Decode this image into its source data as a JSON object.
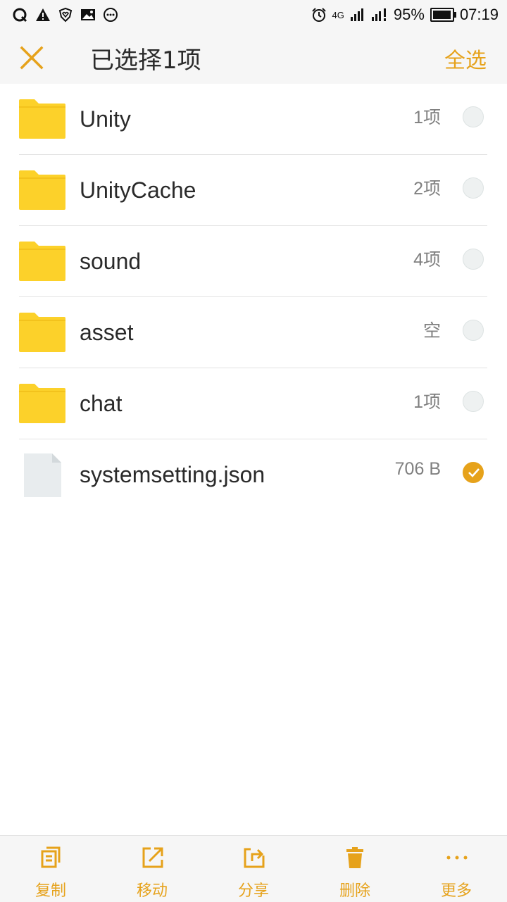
{
  "status_bar": {
    "network": "4G",
    "battery": "95%",
    "battery_level": 0.95,
    "time": "07:19"
  },
  "header": {
    "title": "已选择1项",
    "select_all_label": "全选"
  },
  "files": [
    {
      "name": "Unity",
      "meta": "1项",
      "type": "folder",
      "selected": false
    },
    {
      "name": "UnityCache",
      "meta": "2项",
      "type": "folder",
      "selected": false
    },
    {
      "name": "sound",
      "meta": "4项",
      "type": "folder",
      "selected": false
    },
    {
      "name": "asset",
      "meta": "空",
      "type": "folder",
      "selected": false
    },
    {
      "name": "chat",
      "meta": "1项",
      "type": "folder",
      "selected": false
    },
    {
      "name": "systemsetting.json",
      "meta": "706 B",
      "type": "file",
      "selected": true
    }
  ],
  "toolbar": {
    "copy_label": "复制",
    "move_label": "移动",
    "share_label": "分享",
    "delete_label": "删除",
    "more_label": "更多"
  },
  "colors": {
    "accent": "#e6a21b",
    "folder": "#fcd12a"
  },
  "icons": {
    "folder": "folder-icon",
    "file": "file-icon"
  }
}
